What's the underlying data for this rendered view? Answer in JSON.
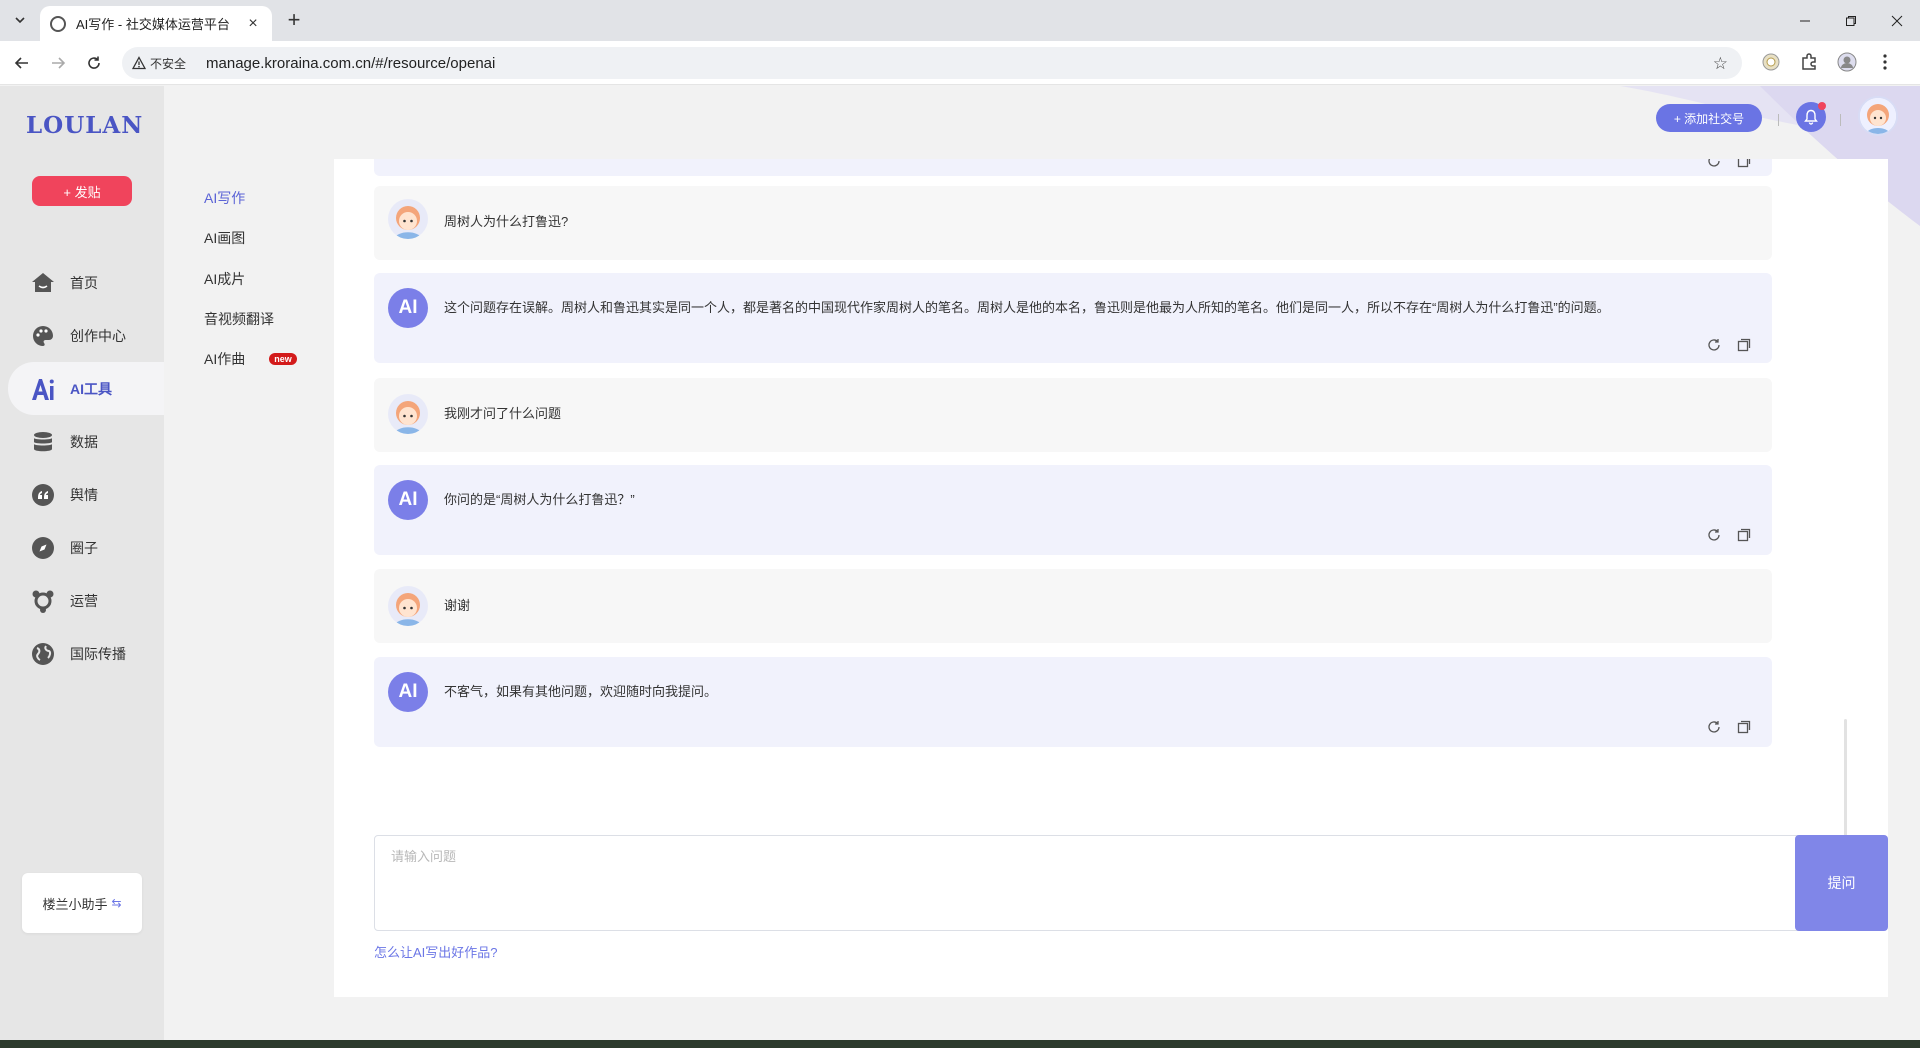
{
  "browser": {
    "tab_title": "AI写作 - 社交媒体运营平台",
    "security_label": "不安全",
    "url": "manage.kroraina.com.cn/#/resource/openai"
  },
  "app": {
    "logo": "LOULAN",
    "post_button": "+ 发贴",
    "nav": [
      {
        "label": "首页",
        "icon": "home-icon"
      },
      {
        "label": "创作中心",
        "icon": "palette-icon"
      },
      {
        "label": "AI工具",
        "icon": "ai-icon",
        "active": true
      },
      {
        "label": "数据",
        "icon": "database-icon"
      },
      {
        "label": "舆情",
        "icon": "quote-icon"
      },
      {
        "label": "圈子",
        "icon": "compass-icon"
      },
      {
        "label": "运营",
        "icon": "operations-icon"
      },
      {
        "label": "国际传播",
        "icon": "globe-icon"
      }
    ],
    "assistant_label": "楼兰小助手",
    "subnav": [
      {
        "label": "AI写作",
        "active": true
      },
      {
        "label": "AI画图"
      },
      {
        "label": "AI成片"
      },
      {
        "label": "音视频翻译"
      },
      {
        "label": "AI作曲",
        "badge": "new"
      }
    ],
    "header": {
      "add_account": "+ 添加社交号"
    }
  },
  "chat": {
    "ai_avatar_text": "AI",
    "messages": [
      {
        "role": "user",
        "text": "周树人为什么打鲁迅?"
      },
      {
        "role": "ai",
        "text": "这个问题存在误解。周树人和鲁迅其实是同一个人，都是著名的中国现代作家周树人的笔名。周树人是他的本名，鲁迅则是他最为人所知的笔名。他们是同一人，所以不存在“周树人为什么打鲁迅”的问题。"
      },
      {
        "role": "user",
        "text": "我刚才问了什么问题"
      },
      {
        "role": "ai",
        "text": "你问的是“周树人为什么打鲁迅？”"
      },
      {
        "role": "user",
        "text": "谢谢"
      },
      {
        "role": "ai",
        "text": "不客气，如果有其他问题，欢迎随时向我提问。"
      }
    ],
    "input_placeholder": "请输入问题",
    "ask_button": "提问",
    "tips_link": "怎么让AI写出好作品?"
  }
}
